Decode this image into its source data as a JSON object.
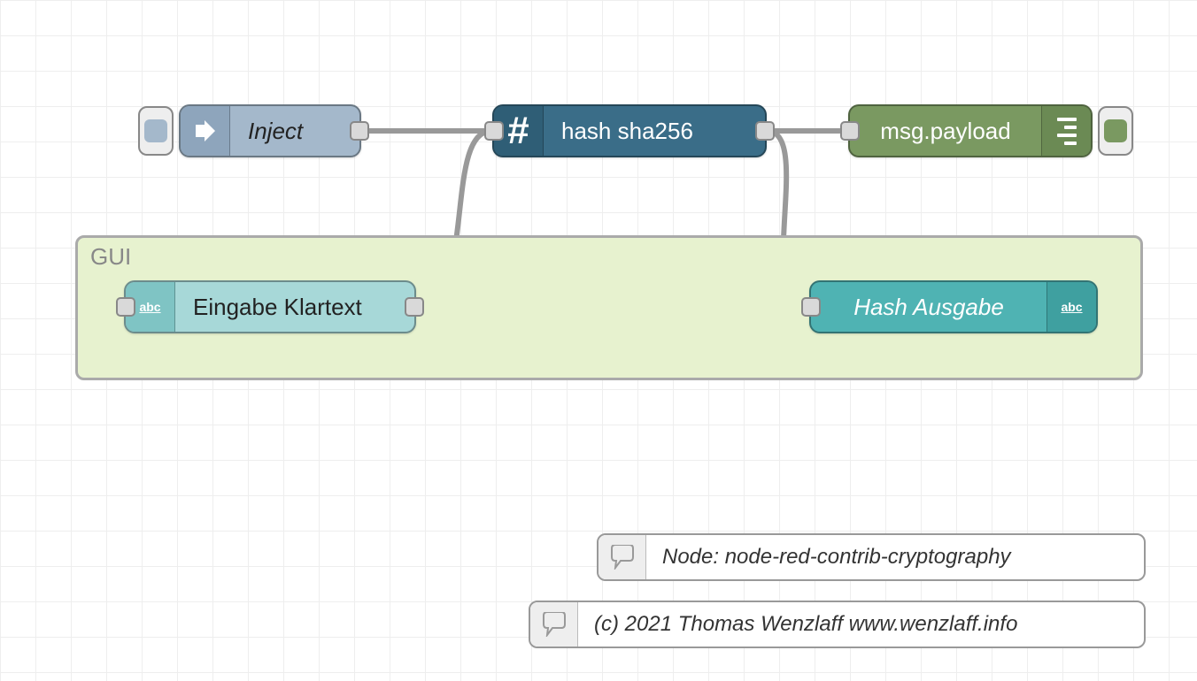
{
  "nodes": {
    "inject": {
      "label": "Inject"
    },
    "hash": {
      "label": "hash sha256"
    },
    "debug": {
      "label": "msg.payload"
    },
    "text_input": {
      "label": "Eingabe Klartext"
    },
    "text_output": {
      "label": "Hash Ausgabe"
    }
  },
  "group": {
    "label": "GUI"
  },
  "comments": {
    "c1": "Node: node-red-contrib-cryptography",
    "c2": "(c) 2021 Thomas Wenzlaff www.wenzlaff.info"
  },
  "colors": {
    "inject_button": "#a4b8cb",
    "debug_button": "#7a9961"
  }
}
